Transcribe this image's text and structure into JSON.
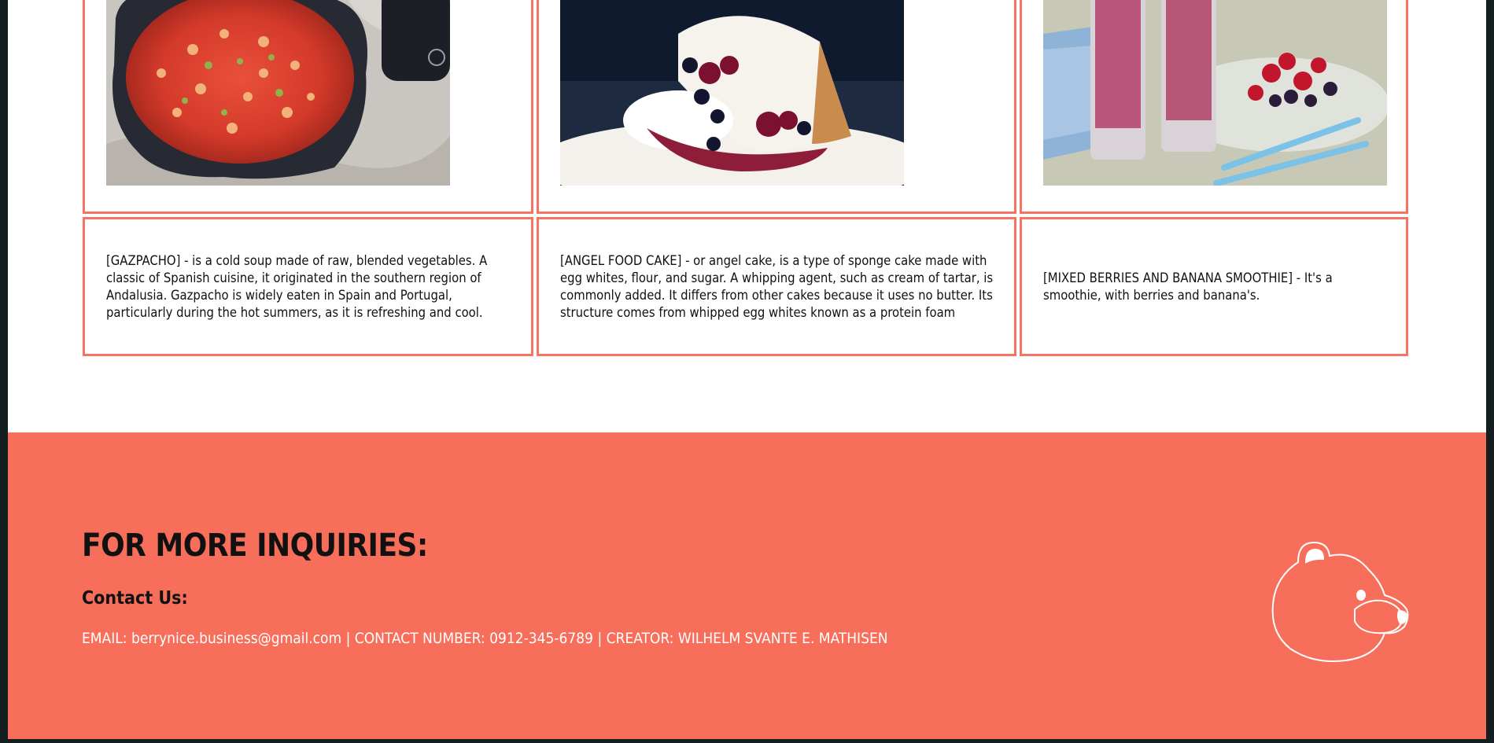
{
  "cards": [
    {
      "image_alt": "gazpacho",
      "description": "[GAZPACHO] - is a cold soup made of raw, blended vegetables. A classic of Spanish cuisine, it originated in the southern region of Andalusia. Gazpacho is widely eaten in Spain and Portugal, particularly during the hot summers, as it is refreshing and cool."
    },
    {
      "image_alt": "angel food cake",
      "description": "[ANGEL FOOD CAKE] - or angel cake, is a type of sponge cake made with egg whites, flour, and sugar. A whipping agent, such as cream of tartar, is commonly added. It differs from other cakes because it uses no butter. Its structure comes from whipped egg whites known as a protein foam"
    },
    {
      "image_alt": "mixed berries and banana smoothie",
      "description": "[MIXED BERRIES AND BANANA SMOOTHIE] - It's a smoothie, with berries and banana's."
    }
  ],
  "footer": {
    "heading": "FOR MORE INQUIRIES:",
    "subheading": "Contact Us:",
    "contact_line": "EMAIL: berrynice.business@gmail.com | CONTACT NUMBER: 0912-345-6789 | CREATOR: WILHELM SVANTE E. MATHISEN",
    "logo_icon": "bear-head-icon"
  },
  "colors": {
    "accent": "#f76e5a",
    "border": "#f47361",
    "outer_background": "#141d1f"
  }
}
